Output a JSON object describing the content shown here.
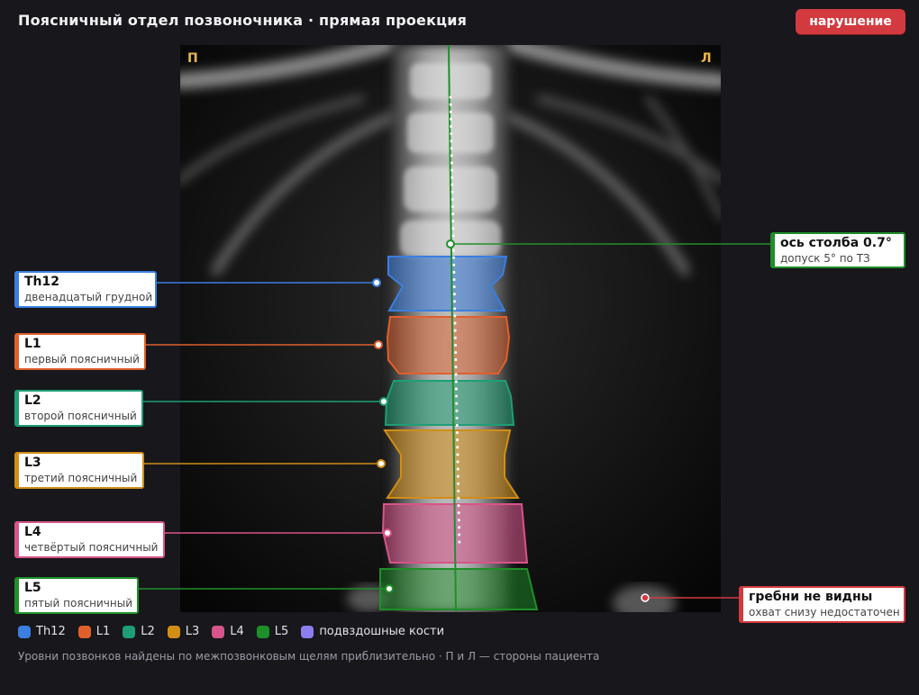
{
  "header": {
    "title": "Поясничный отдел позвоночника · прямая проекция",
    "badge": "нарушение"
  },
  "image": {
    "side_left": "П",
    "side_right": "Л"
  },
  "axis_callout": {
    "title": "ось столба 0.7°",
    "subtitle": "допуск 5° по ТЗ",
    "color": "#1f8f2a"
  },
  "vertebrae": [
    {
      "code": "Th12",
      "label": "двенадцатый грудной",
      "color": "#3b7fe0"
    },
    {
      "code": "L1",
      "label": "первый поясничный",
      "color": "#e0602c"
    },
    {
      "code": "L2",
      "label": "второй поясничный",
      "color": "#1f9e75"
    },
    {
      "code": "L3",
      "label": "третий поясничный",
      "color": "#d18e16"
    },
    {
      "code": "L4",
      "label": "четвёртый поясничный",
      "color": "#d8548a"
    },
    {
      "code": "L5",
      "label": "пятый поясничный",
      "color": "#1f8f2a"
    }
  ],
  "crest_callout": {
    "title": "гребни не видны",
    "subtitle": "охват снизу недостаточен",
    "color": "#d33a3f"
  },
  "legend": [
    {
      "label": "Th12",
      "color": "#3b7fe0"
    },
    {
      "label": "L1",
      "color": "#e0602c"
    },
    {
      "label": "L2",
      "color": "#1f9e75"
    },
    {
      "label": "L3",
      "color": "#d18e16"
    },
    {
      "label": "L4",
      "color": "#d8548a"
    },
    {
      "label": "L5",
      "color": "#1f8f2a"
    },
    {
      "label": "подвздошные кости",
      "color": "#8c7ef0"
    }
  ],
  "footnote": "Уровни позвонков найдены по межпозвонковым щелям приблизительно · П и Л — стороны пациента"
}
